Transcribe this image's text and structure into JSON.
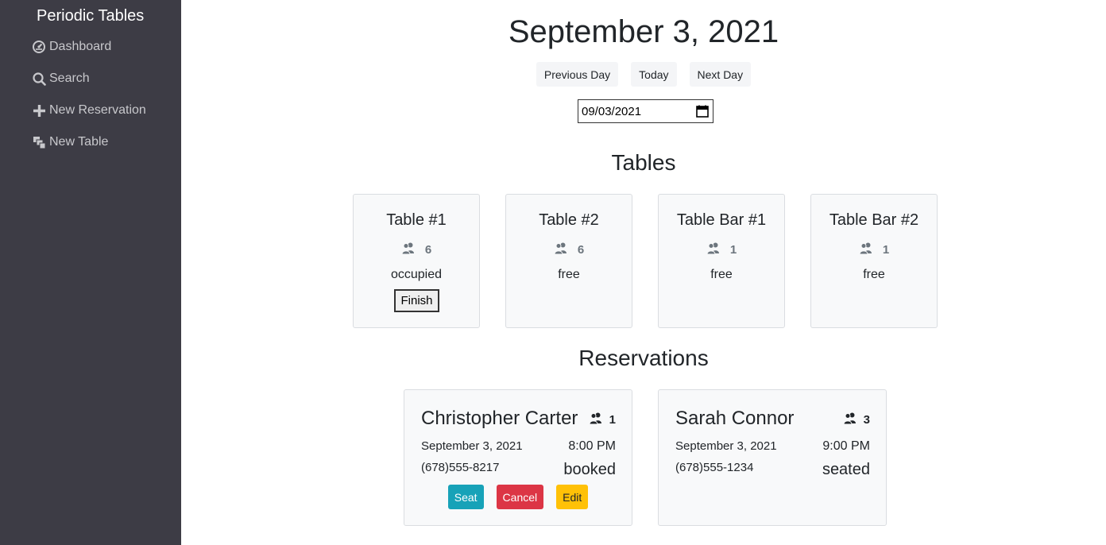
{
  "sidebar": {
    "brand": "Periodic Tables",
    "items": [
      {
        "label": "Dashboard",
        "icon": "dashboard-icon"
      },
      {
        "label": "Search",
        "icon": "search-icon"
      },
      {
        "label": "New Reservation",
        "icon": "plus-icon"
      },
      {
        "label": "New Table",
        "icon": "layers-icon"
      }
    ]
  },
  "header": {
    "date_title": "September 3, 2021",
    "prev_label": "Previous Day",
    "today_label": "Today",
    "next_label": "Next Day",
    "date_input_value": "09/03/2021"
  },
  "tables_section": {
    "title": "Tables",
    "tables": [
      {
        "name": "Table #1",
        "capacity": "6",
        "status": "occupied",
        "finish_label": "Finish"
      },
      {
        "name": "Table #2",
        "capacity": "6",
        "status": "free"
      },
      {
        "name": "Table Bar #1",
        "capacity": "1",
        "status": "free"
      },
      {
        "name": "Table Bar #2",
        "capacity": "1",
        "status": "free"
      }
    ]
  },
  "reservations_section": {
    "title": "Reservations",
    "reservations": [
      {
        "name": "Christopher Carter",
        "people": "1",
        "date": "September 3, 2021",
        "time": "8:00 PM",
        "phone": "(678)555-8217",
        "status": "booked",
        "seat_label": "Seat",
        "cancel_label": "Cancel",
        "edit_label": "Edit"
      },
      {
        "name": "Sarah Connor",
        "people": "3",
        "date": "September 3, 2021",
        "time": "9:00 PM",
        "phone": "(678)555-1234",
        "status": "seated"
      }
    ]
  },
  "colors": {
    "sidebar_bg": "#3d3c45",
    "seat": "#17a2b8",
    "cancel": "#dc3545",
    "edit": "#ffc107"
  }
}
